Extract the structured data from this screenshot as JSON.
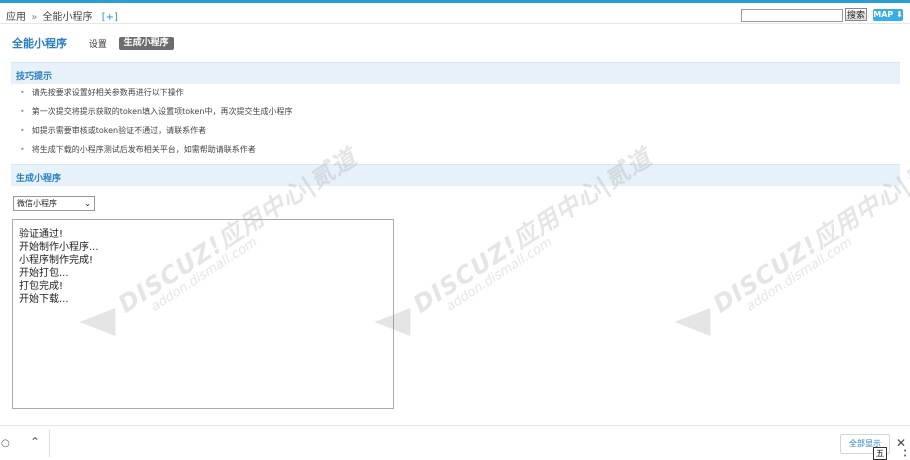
{
  "topbar": {
    "breadcrumb": [
      "应用",
      "全能小程序"
    ],
    "breadcrumb_sep": "»",
    "add_link": "[+]",
    "search_value": "",
    "search_button": "搜索",
    "map_button": "MAP"
  },
  "header": {
    "title": "全能小程序",
    "nav_setting": "设置",
    "nav_active": "生成小程序"
  },
  "tips_section": {
    "title": "技巧提示",
    "items": [
      "请先按要求设置好相关参数再进行以下操作",
      "第一次提交将提示获取的token填入设置项token中，再次提交生成小程序",
      "如提示需要审核或token验证不通过，请联系作者",
      "将生成下载的小程序测试后发布相关平台，如需帮助请联系作者"
    ]
  },
  "generate_section": {
    "title": "生成小程序",
    "select_value": "微信小程序",
    "log_lines": [
      "验证通过!",
      "开始制作小程序...",
      "小程序制作完成!",
      "开始打包...",
      "打包完成!",
      "开始下载..."
    ]
  },
  "watermark": {
    "line1": "DISCUZ!应用中心|贰道",
    "line2": "addon.dismall.com"
  },
  "bottom_bar": {
    "show_all": "全部显示",
    "ime_badge": "五"
  }
}
